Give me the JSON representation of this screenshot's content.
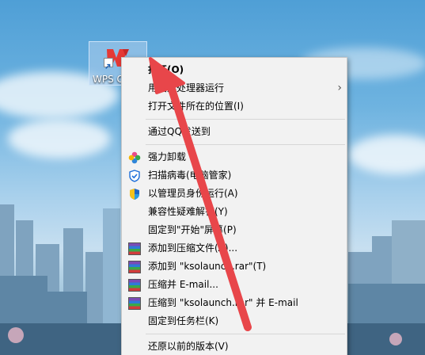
{
  "desktop": {
    "icon_label": "WPS Office"
  },
  "context_menu": {
    "items": [
      {
        "label": "打开(O)",
        "bold": true,
        "icon": ""
      },
      {
        "label": "用图形处理器运行",
        "icon": "",
        "submenu": true
      },
      {
        "label": "打开文件所在的位置(I)",
        "icon": ""
      },
      {
        "label": "通过QQ发送到",
        "icon": ""
      },
      {
        "label": "强力卸载",
        "icon": "clover-icon"
      },
      {
        "label": "扫描病毒(电脑管家)",
        "icon": "shield-check-icon"
      },
      {
        "label": "以管理员身份运行(A)",
        "icon": "uac-shield-icon"
      },
      {
        "label": "兼容性疑难解答(Y)",
        "icon": ""
      },
      {
        "label": "固定到\"开始\"屏幕(P)",
        "icon": ""
      },
      {
        "label": "添加到压缩文件(A)...",
        "icon": "winrar-icon"
      },
      {
        "label": "添加到 \"ksolaunch.rar\"(T)",
        "icon": "winrar-icon"
      },
      {
        "label": "压缩并 E-mail...",
        "icon": "winrar-icon"
      },
      {
        "label": "压缩到 \"ksolaunch.rar\" 并 E-mail",
        "icon": "winrar-icon"
      },
      {
        "label": "固定到任务栏(K)",
        "icon": ""
      },
      {
        "label": "还原以前的版本(V)",
        "icon": ""
      }
    ],
    "submenu_arrow": "›"
  },
  "colors": {
    "annotation_arrow": "#e8464a",
    "menu_bg": "#f2f2f2"
  }
}
